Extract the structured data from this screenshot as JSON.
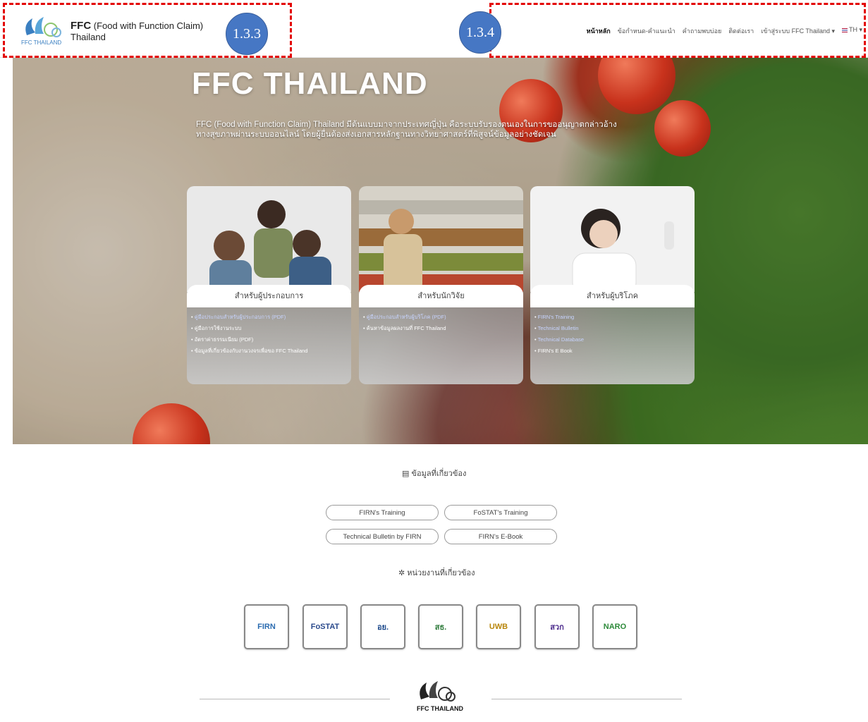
{
  "header": {
    "brand_bold": "FFC",
    "brand_rest": " (Food with Function Claim)",
    "brand_line2": "Thailand",
    "logo_caption": "FFC THAILAND",
    "nav": [
      {
        "label": "หน้าหลัก",
        "active": true
      },
      {
        "label": "ข้อกำหนด-คำแนะนำ",
        "active": false
      },
      {
        "label": "คำถามพบบ่อย",
        "active": false
      },
      {
        "label": "ติดต่อเรา",
        "active": false
      },
      {
        "label": "เข้าสู่ระบบ FFC Thailand ▾",
        "active": false
      },
      {
        "label": "TH ▾",
        "active": false
      }
    ]
  },
  "annotations": {
    "badge_left": "1.3.3",
    "badge_right": "1.3.4",
    "accent_color": "#e30000",
    "badge_color": "#4677c4"
  },
  "hero": {
    "title": "FFC THAILAND",
    "description": "FFC (Food with Function Claim) Thailand มีต้นแบบมาจากประเทศญี่ปุ่น คือระบบรับรองตนเองในการขออนุญาตกล่าวอ้างทางสุขภาพผ่านระบบออนไลน์ โดยผู้ยื่นต้องส่งเอกสารหลักฐานทางวิทยาศาสตร์ที่พิสูจน์ข้อมูลอย่างชัดเจน"
  },
  "cards": [
    {
      "label": "สำหรับผู้ประกอบการ",
      "links": [
        {
          "text": "คู่มือประกอบสำหรับผู้ประกอบการ (PDF)",
          "link": true
        },
        {
          "text": "คู่มือการใช้งานระบบ",
          "link": false
        },
        {
          "text": "อัตราค่าธรรมเนียม (PDF)",
          "link": false
        },
        {
          "text": "ข้อมูลที่เกี่ยวข้องกับงานวงจรเพื่อขอ FFC Thailand",
          "link": false
        }
      ]
    },
    {
      "label": "สำหรับนักวิจัย",
      "links": [
        {
          "text": "คู่มือประกอบสำหรับผู้บริโภค (PDF)",
          "link": true
        },
        {
          "text": "ค้นหาข้อมูลผลงานที่ FFC Thailand",
          "link": false
        }
      ]
    },
    {
      "label": "สำหรับผู้บริโภค",
      "links": [
        {
          "text": "FIRN's Training",
          "link": true
        },
        {
          "text": "Technical Bulletin",
          "link": true
        },
        {
          "text": "Technical Database",
          "link": true
        },
        {
          "text": "FIRN's E Book",
          "link": false
        }
      ]
    }
  ],
  "related_info": {
    "title": "ข้อมูลที่เกี่ยวข้อง",
    "buttons": [
      "FIRN's Training",
      "FoSTAT's Training",
      "Technical Bulletin by FIRN",
      "FIRN's E-Book"
    ]
  },
  "related_orgs": {
    "title": "หน่วยงานที่เกี่ยวข้อง",
    "logos": [
      "FIRN",
      "FoSTAT",
      "อย.",
      "สธ.",
      "UWB",
      "สวก",
      "NARO"
    ]
  },
  "footer": {
    "logo_caption": "FFC THAILAND"
  }
}
